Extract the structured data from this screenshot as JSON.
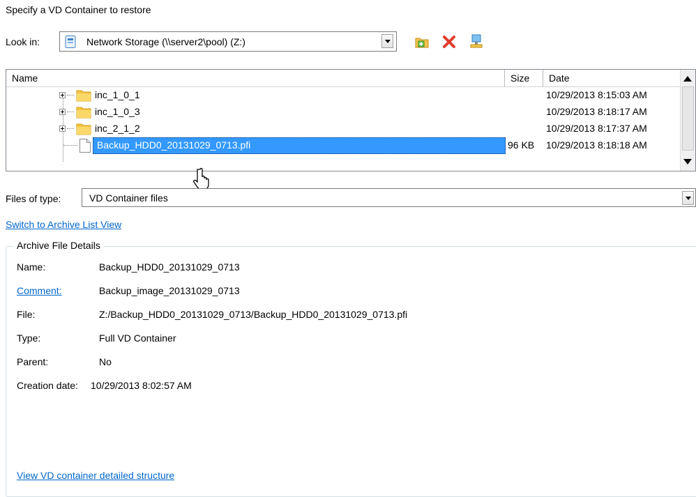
{
  "dialog": {
    "title": "Specify a VD Container to restore"
  },
  "look_in": {
    "label": "Look in:",
    "value": "Network Storage (\\\\server2\\pool) (Z:)",
    "icon": "network-drive-icon"
  },
  "toolbar": {
    "icons": [
      "new-folder-icon",
      "delete-icon",
      "network-icon"
    ]
  },
  "file_list": {
    "columns": [
      "Name",
      "Size",
      "Date"
    ],
    "rows": [
      {
        "name": "inc_1_0_1",
        "size": "",
        "date": "10/29/2013 8:15:03 AM",
        "kind": "folder"
      },
      {
        "name": "inc_1_0_3",
        "size": "",
        "date": "10/29/2013 8:18:17 AM",
        "kind": "folder"
      },
      {
        "name": "inc_2_1_2",
        "size": "",
        "date": "10/29/2013 8:17:37 AM",
        "kind": "folder"
      },
      {
        "name": "Backup_HDD0_20131029_0713.pfi",
        "size": "96 KB",
        "date": "10/29/2013 8:18:18 AM",
        "kind": "file",
        "selected": true
      }
    ]
  },
  "files_of_type": {
    "label": "Files of type:",
    "value": "VD Container files"
  },
  "switch_link": "Switch to Archive List View",
  "details": {
    "legend": "Archive File Details",
    "fields": [
      {
        "label": "Name:",
        "value": "Backup_HDD0_20131029_0713"
      },
      {
        "label": "Comment:",
        "value": "Backup_image_20131029_0713"
      },
      {
        "label": "File:",
        "value": "Z:/Backup_HDD0_20131029_0713/Backup_HDD0_20131029_0713.pfi"
      },
      {
        "label": "Type:",
        "value": "Full VD Container"
      },
      {
        "label": "Parent:",
        "value": "No"
      },
      {
        "label": "Creation date:",
        "value": "10/29/2013 8:02:57 AM"
      }
    ],
    "view_link": "View VD container detailed structure"
  },
  "colors": {
    "selection": "#3399ff",
    "link": "#0066cc"
  }
}
